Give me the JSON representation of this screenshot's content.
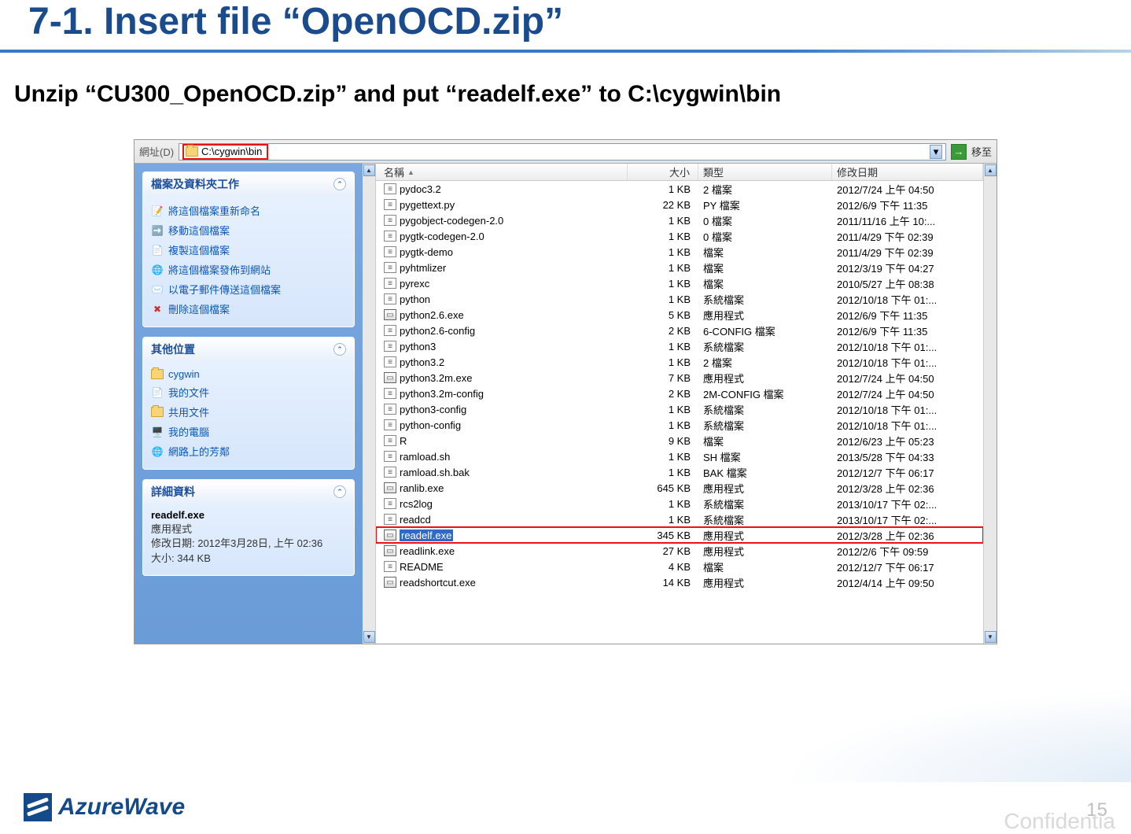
{
  "slide": {
    "title": "7-1. Insert file “OpenOCD.zip”",
    "subtitle": "Unzip “CU300_OpenOCD.zip” and put “readelf.exe” to C:\\cygwin\\bin"
  },
  "addressbar": {
    "label": "網址(D)",
    "path": "C:\\cygwin\\bin",
    "go_label": "移至"
  },
  "sidebar": {
    "tasks": {
      "title": "檔案及資料夾工作",
      "items": [
        "將這個檔案重新命名",
        "移動這個檔案",
        "複製這個檔案",
        "將這個檔案發佈到網站",
        "以電子郵件傳送這個檔案",
        "刪除這個檔案"
      ]
    },
    "places": {
      "title": "其他位置",
      "items": [
        "cygwin",
        "我的文件",
        "共用文件",
        "我的電腦",
        "網路上的芳鄰"
      ]
    },
    "details": {
      "title": "詳細資料",
      "filename": "readelf.exe",
      "filetype": "應用程式",
      "modified_label": "修改日期: 2012年3月28日, 上午 02:36",
      "size_label": "大小: 344 KB"
    }
  },
  "columns": {
    "name": "名稱",
    "size": "大小",
    "type": "類型",
    "date": "修改日期"
  },
  "files": [
    {
      "name": "pydoc3.2",
      "size": "1 KB",
      "type": "2 檔案",
      "date": "2012/7/24 上午 04:50",
      "icon": "cfg"
    },
    {
      "name": "pygettext.py",
      "size": "22 KB",
      "type": "PY 檔案",
      "date": "2012/6/9 下午 11:35",
      "icon": "cfg"
    },
    {
      "name": "pygobject-codegen-2.0",
      "size": "1 KB",
      "type": "0 檔案",
      "date": "2011/11/16 上午 10:...",
      "icon": "cfg"
    },
    {
      "name": "pygtk-codegen-2.0",
      "size": "1 KB",
      "type": "0 檔案",
      "date": "2011/4/29 下午 02:39",
      "icon": "cfg"
    },
    {
      "name": "pygtk-demo",
      "size": "1 KB",
      "type": "檔案",
      "date": "2011/4/29 下午 02:39",
      "icon": "cfg"
    },
    {
      "name": "pyhtmlizer",
      "size": "1 KB",
      "type": "檔案",
      "date": "2012/3/19 下午 04:27",
      "icon": "cfg"
    },
    {
      "name": "pyrexc",
      "size": "1 KB",
      "type": "檔案",
      "date": "2010/5/27 上午 08:38",
      "icon": "cfg"
    },
    {
      "name": "python",
      "size": "1 KB",
      "type": "系統檔案",
      "date": "2012/10/18 下午 01:...",
      "icon": "cfg"
    },
    {
      "name": "python2.6.exe",
      "size": "5 KB",
      "type": "應用程式",
      "date": "2012/6/9 下午 11:35",
      "icon": "exe"
    },
    {
      "name": "python2.6-config",
      "size": "2 KB",
      "type": "6-CONFIG 檔案",
      "date": "2012/6/9 下午 11:35",
      "icon": "cfg"
    },
    {
      "name": "python3",
      "size": "1 KB",
      "type": "系統檔案",
      "date": "2012/10/18 下午 01:...",
      "icon": "cfg"
    },
    {
      "name": "python3.2",
      "size": "1 KB",
      "type": "2 檔案",
      "date": "2012/10/18 下午 01:...",
      "icon": "cfg"
    },
    {
      "name": "python3.2m.exe",
      "size": "7 KB",
      "type": "應用程式",
      "date": "2012/7/24 上午 04:50",
      "icon": "exe"
    },
    {
      "name": "python3.2m-config",
      "size": "2 KB",
      "type": "2M-CONFIG 檔案",
      "date": "2012/7/24 上午 04:50",
      "icon": "cfg"
    },
    {
      "name": "python3-config",
      "size": "1 KB",
      "type": "系統檔案",
      "date": "2012/10/18 下午 01:...",
      "icon": "cfg"
    },
    {
      "name": "python-config",
      "size": "1 KB",
      "type": "系統檔案",
      "date": "2012/10/18 下午 01:...",
      "icon": "cfg"
    },
    {
      "name": "R",
      "size": "9 KB",
      "type": "檔案",
      "date": "2012/6/23 上午 05:23",
      "icon": "cfg"
    },
    {
      "name": "ramload.sh",
      "size": "1 KB",
      "type": "SH 檔案",
      "date": "2013/5/28 下午 04:33",
      "icon": "cfg"
    },
    {
      "name": "ramload.sh.bak",
      "size": "1 KB",
      "type": "BAK 檔案",
      "date": "2012/12/7 下午 06:17",
      "icon": "cfg"
    },
    {
      "name": "ranlib.exe",
      "size": "645 KB",
      "type": "應用程式",
      "date": "2012/3/28 上午 02:36",
      "icon": "exe"
    },
    {
      "name": "rcs2log",
      "size": "1 KB",
      "type": "系統檔案",
      "date": "2013/10/17 下午 02:...",
      "icon": "cfg"
    },
    {
      "name": "readcd",
      "size": "1 KB",
      "type": "系統檔案",
      "date": "2013/10/17 下午 02:...",
      "icon": "cfg"
    },
    {
      "name": "readelf.exe",
      "size": "345 KB",
      "type": "應用程式",
      "date": "2012/3/28 上午 02:36",
      "icon": "exe",
      "selected": true,
      "highlighted": true
    },
    {
      "name": "readlink.exe",
      "size": "27 KB",
      "type": "應用程式",
      "date": "2012/2/6 下午 09:59",
      "icon": "exe"
    },
    {
      "name": "README",
      "size": "4 KB",
      "type": "檔案",
      "date": "2012/12/7 下午 06:17",
      "icon": "cfg"
    },
    {
      "name": "readshortcut.exe",
      "size": "14 KB",
      "type": "應用程式",
      "date": "2012/4/14 上午 09:50",
      "icon": "exe"
    }
  ],
  "footer": {
    "logo_text": "AzureWave",
    "page_number": "15",
    "confidential": "Confidentia"
  }
}
